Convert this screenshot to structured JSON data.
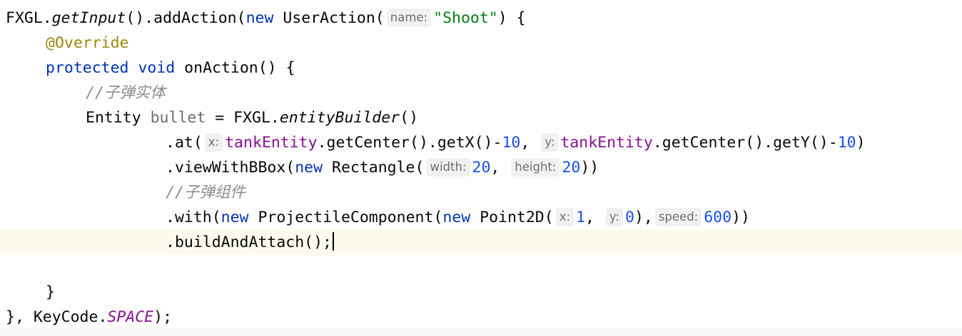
{
  "editor": {
    "lines": [
      {
        "id": "l1",
        "segments": [
          {
            "t": "FXGL."
          },
          {
            "t": "getInput",
            "c": "it"
          },
          {
            "t": "().addAction("
          },
          {
            "t": "new",
            "c": "kw"
          },
          {
            "t": " UserAction("
          },
          {
            "t": "name:",
            "c": "hint"
          },
          {
            "t": "\"Shoot\"",
            "c": "st"
          },
          {
            "t": ") {"
          }
        ]
      },
      {
        "id": "l2",
        "segments": [
          {
            "t": "@Override",
            "c": "ann"
          }
        ]
      },
      {
        "id": "l3",
        "segments": [
          {
            "t": "protected",
            "c": "kw"
          },
          {
            "t": " "
          },
          {
            "t": "void",
            "c": "kw"
          },
          {
            "t": " onAction() {"
          }
        ]
      },
      {
        "id": "l4",
        "segments": [
          {
            "t": "//子弹实体",
            "c": "cm"
          }
        ]
      },
      {
        "id": "l5",
        "segments": [
          {
            "t": "Entity "
          },
          {
            "t": "bullet",
            "c": "unused"
          },
          {
            "t": " = FXGL."
          },
          {
            "t": "entityBuilder",
            "c": "it"
          },
          {
            "t": "()"
          }
        ]
      },
      {
        "id": "l6",
        "segments": [
          {
            "t": ".at("
          },
          {
            "t": "x:",
            "c": "hint"
          },
          {
            "t": "tankEntity",
            "c": "fld"
          },
          {
            "t": ".getCenter().getX()-"
          },
          {
            "t": "10",
            "c": "num"
          },
          {
            "t": ", "
          },
          {
            "t": "y:",
            "c": "hint"
          },
          {
            "t": "tankEntity",
            "c": "fld"
          },
          {
            "t": ".getCenter().getY()-"
          },
          {
            "t": "10",
            "c": "num"
          },
          {
            "t": ")"
          }
        ]
      },
      {
        "id": "l7",
        "segments": [
          {
            "t": ".viewWithBBox("
          },
          {
            "t": "new",
            "c": "kw"
          },
          {
            "t": " Rectangle("
          },
          {
            "t": "width:",
            "c": "hint"
          },
          {
            "t": "20",
            "c": "num"
          },
          {
            "t": ", "
          },
          {
            "t": "height:",
            "c": "hint"
          },
          {
            "t": "20",
            "c": "num"
          },
          {
            "t": "))"
          }
        ]
      },
      {
        "id": "l8",
        "segments": [
          {
            "t": "//子弹组件",
            "c": "cm"
          }
        ]
      },
      {
        "id": "l9",
        "segments": [
          {
            "t": ".with("
          },
          {
            "t": "new",
            "c": "kw"
          },
          {
            "t": " ProjectileComponent("
          },
          {
            "t": "new",
            "c": "kw"
          },
          {
            "t": " Point2D("
          },
          {
            "t": "x:",
            "c": "hint"
          },
          {
            "t": "1",
            "c": "num"
          },
          {
            "t": ", "
          },
          {
            "t": "y:",
            "c": "hint"
          },
          {
            "t": "0",
            "c": "num"
          },
          {
            "t": "),"
          },
          {
            "t": "speed:",
            "c": "hint"
          },
          {
            "t": "600",
            "c": "num"
          },
          {
            "t": "))"
          }
        ]
      },
      {
        "id": "l10",
        "segments": [
          {
            "t": ".buildAndAttach();"
          },
          {
            "caret": true
          }
        ]
      },
      {
        "id": "l11",
        "segments": []
      },
      {
        "id": "l12",
        "segments": [
          {
            "t": "}"
          }
        ]
      },
      {
        "id": "l13",
        "segments": [
          {
            "t": "}, KeyCode."
          },
          {
            "t": "SPACE",
            "c": "const"
          },
          {
            "t": ");"
          }
        ]
      }
    ]
  }
}
